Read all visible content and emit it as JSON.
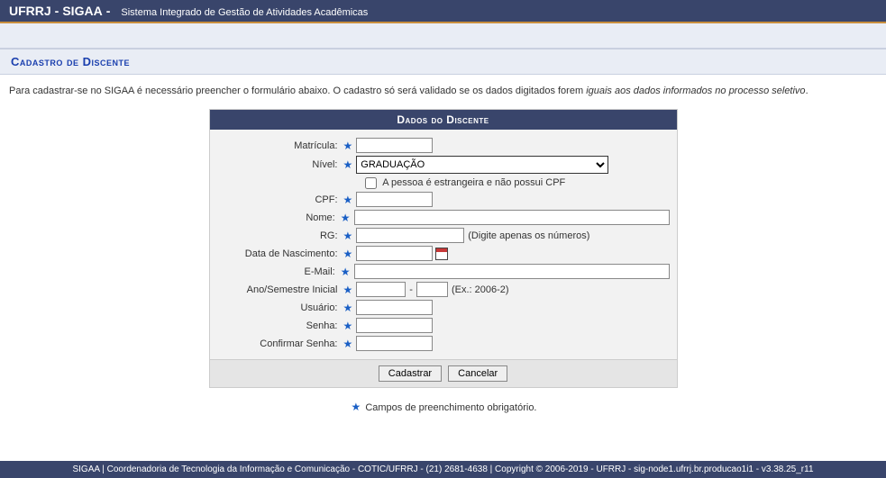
{
  "header": {
    "acronym_a": "UFRRJ",
    "acronym_b": "SIGAA",
    "dash": "-",
    "system_name": "Sistema Integrado de Gestão de Atividades Acadêmicas"
  },
  "section_title": "Cadastro de Discente",
  "intro_plain": "Para cadastrar-se no SIGAA é necessário preencher o formulário abaixo. O cadastro só será validado se os dados digitados forem ",
  "intro_em": "iguais aos dados informados no processo seletivo",
  "intro_period": ".",
  "form": {
    "title": "Dados do Discente",
    "matricula_label": "Matrícula:",
    "nivel_label": "Nível:",
    "nivel_value": "GRADUAÇÃO",
    "estrangeira_label": "A pessoa é estrangeira e não possui CPF",
    "cpf_label": "CPF:",
    "nome_label": "Nome:",
    "rg_label": "RG:",
    "rg_hint": "(Digite apenas os números)",
    "data_nasc_label": "Data de Nascimento:",
    "email_label": "E-Mail:",
    "ano_sem_label": "Ano/Semestre Inicial",
    "ano_sem_hint": "(Ex.: 2006-2)",
    "ano_sem_sep": "-",
    "usuario_label": "Usuário:",
    "senha_label": "Senha:",
    "conf_senha_label": "Confirmar Senha:"
  },
  "buttons": {
    "submit": "Cadastrar",
    "cancel": "Cancelar"
  },
  "legend": "Campos de preenchimento obrigatório.",
  "footer": "SIGAA | Coordenadoria de Tecnologia da Informação e Comunicação - COTIC/UFRRJ - (21) 2681-4638 | Copyright © 2006-2019 - UFRRJ - sig-node1.ufrrj.br.producao1i1 - v3.38.25_r11"
}
